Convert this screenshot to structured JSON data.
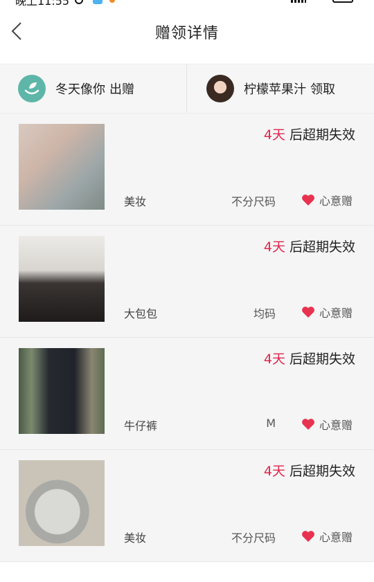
{
  "status": {
    "time": "晚上11:55"
  },
  "header": {
    "title": "赠领详情"
  },
  "giver": {
    "name": "冬天像你",
    "action": "出赠"
  },
  "receiver": {
    "name": "柠檬苹果汁",
    "action": "领取"
  },
  "items": [
    {
      "days": "4天",
      "expire_suffix": "后超期失效",
      "category": "美妆",
      "size": "不分尺码",
      "gift": "心意赠"
    },
    {
      "days": "4天",
      "expire_suffix": "后超期失效",
      "category": "大包包",
      "size": "均码",
      "gift": "心意赠"
    },
    {
      "days": "4天",
      "expire_suffix": "后超期失效",
      "category": "牛仔裤",
      "size": "M",
      "gift": "心意赠"
    },
    {
      "days": "4天",
      "expire_suffix": "后超期失效",
      "category": "美妆",
      "size": "不分尺码",
      "gift": "心意赠"
    }
  ],
  "colors": {
    "accent": "#e2264d",
    "heart": "#e8334f",
    "avatar_bg": "#5eb6a8"
  },
  "icons": {
    "back": "chevron-left-icon",
    "heart": "heart-icon"
  }
}
